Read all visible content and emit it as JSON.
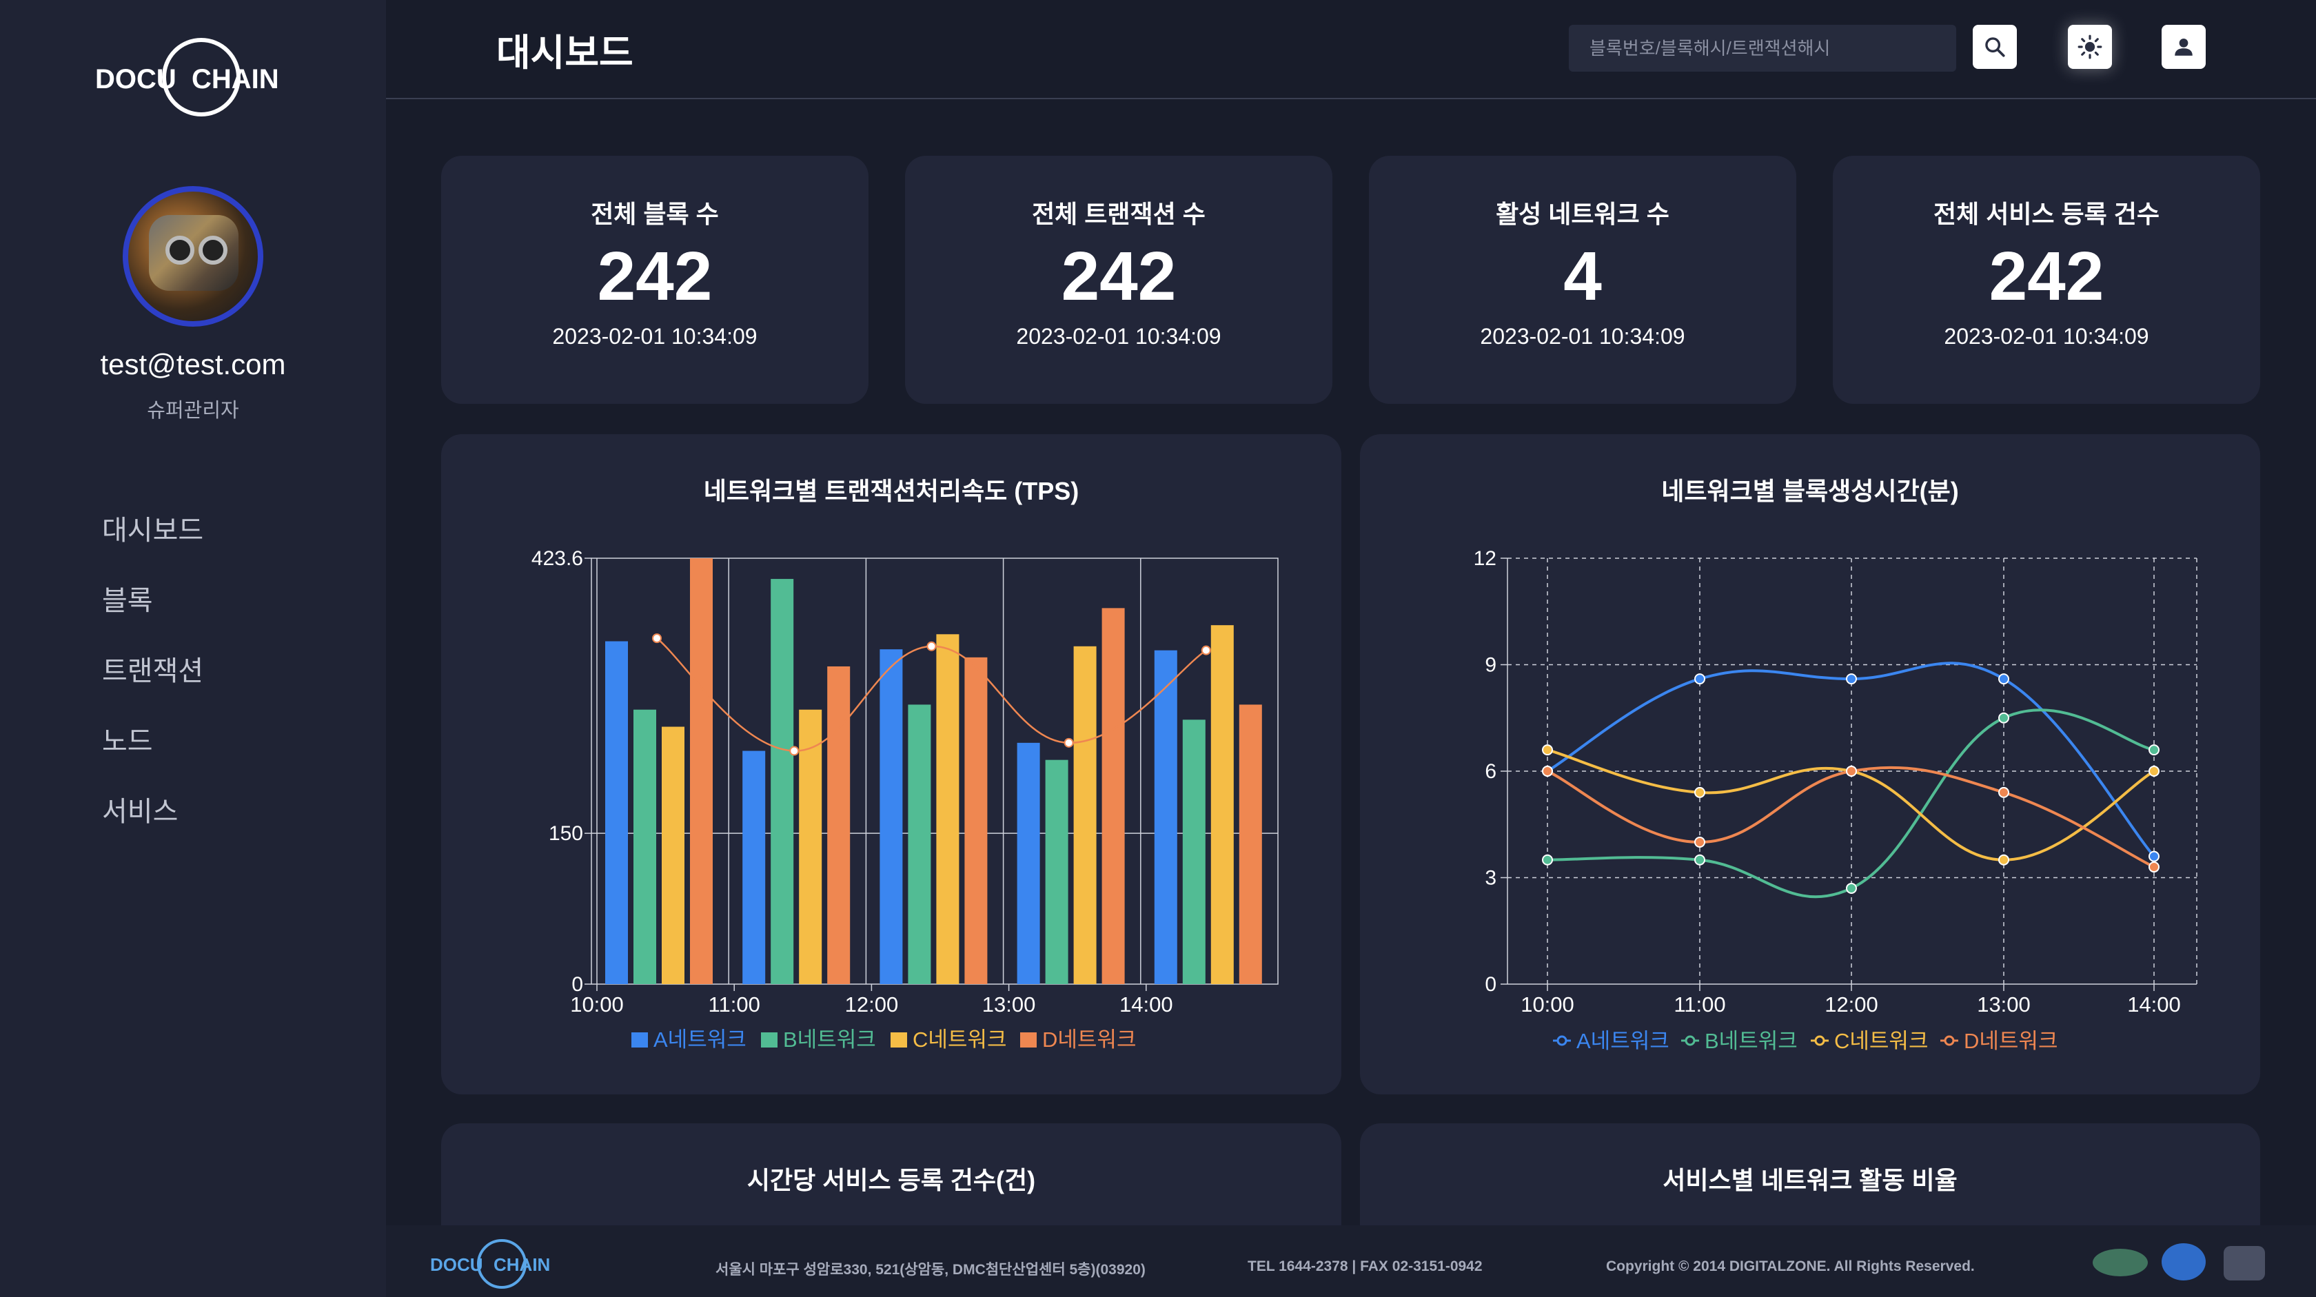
{
  "brand": {
    "logo_left": "DOCU",
    "logo_right": "CHAIN"
  },
  "user": {
    "email": "test@test.com",
    "role": "슈퍼관리자"
  },
  "nav": [
    {
      "label": "대시보드"
    },
    {
      "label": "블록"
    },
    {
      "label": "트랜잭션"
    },
    {
      "label": "노드"
    },
    {
      "label": "서비스"
    }
  ],
  "header": {
    "title": "대시보드",
    "search_placeholder": "블록번호/블록해시/트랜잭션해시",
    "icons": [
      "search-icon",
      "sun-icon",
      "user-icon"
    ]
  },
  "stats": [
    {
      "label": "전체 블록 수",
      "value": "242",
      "time": "2023-02-01 10:34:09"
    },
    {
      "label": "전체 트랜잭션 수",
      "value": "242",
      "time": "2023-02-01 10:34:09"
    },
    {
      "label": "활성 네트워크 수",
      "value": "4",
      "time": "2023-02-01 10:34:09"
    },
    {
      "label": "전체 서비스 등록 건수",
      "value": "242",
      "time": "2023-02-01 10:34:09"
    }
  ],
  "chart_titles": {
    "tps": "네트워크별 트랜잭션처리속도 (TPS)",
    "block_time": "네트워크별 블록생성시간(분)",
    "hourly_service": "시간당 서비스 등록 건수(건)",
    "service_ratio": "서비스별 네트워크 활동 비율"
  },
  "colors": {
    "A": "#3b86f0",
    "B": "#52bc94",
    "C": "#f5bd46",
    "D": "#ef8751"
  },
  "chart_data": [
    {
      "type": "bar",
      "title": "네트워크별 트랜잭션처리속도 (TPS)",
      "categories": [
        "10:00",
        "11:00",
        "12:00",
        "13:00",
        "14:00"
      ],
      "ytick_labels": [
        "0",
        "150",
        "423.6"
      ],
      "ylim": [
        0,
        423.6
      ],
      "series": [
        {
          "name": "A네트워크",
          "values": [
            341,
            232,
            333,
            240,
            332
          ]
        },
        {
          "name": "B네트워크",
          "values": [
            273,
            403,
            278,
            223,
            263
          ]
        },
        {
          "name": "C네트워크",
          "values": [
            256,
            273,
            348,
            336,
            357
          ]
        },
        {
          "name": "D네트워크",
          "values": [
            423.6,
            316,
            325,
            374,
            278
          ]
        }
      ],
      "line_series": {
        "values": [
          344,
          232,
          336,
          240,
          332
        ]
      },
      "legend": "bottom"
    },
    {
      "type": "line",
      "title": "네트워크별 블록생성시간(분)",
      "x": [
        "10:00",
        "11:00",
        "12:00",
        "13:00",
        "14:00"
      ],
      "yticks": [
        0,
        3,
        6,
        9,
        12
      ],
      "ylim": [
        0,
        12
      ],
      "grid": "dashed",
      "series": [
        {
          "name": "A네트워크",
          "values": [
            6.0,
            8.6,
            8.6,
            8.6,
            3.6
          ]
        },
        {
          "name": "B네트워크",
          "values": [
            3.5,
            3.5,
            2.7,
            7.5,
            6.6
          ]
        },
        {
          "name": "C네트워크",
          "values": [
            6.6,
            5.4,
            6.0,
            3.5,
            6.0
          ]
        },
        {
          "name": "D네트워크",
          "values": [
            6.0,
            4.0,
            6.0,
            5.4,
            3.3
          ]
        }
      ],
      "legend": "bottom"
    }
  ],
  "footer": {
    "address": "서울시 마포구 성암로330, 521(상암동, DMC첨단산업센터 5층)(03920)",
    "contact": "TEL 1644-2378 |  FAX 02-3151-0942",
    "copyright": "Copyright © 2014 DIGITALZONE. All Rights Reserved."
  }
}
